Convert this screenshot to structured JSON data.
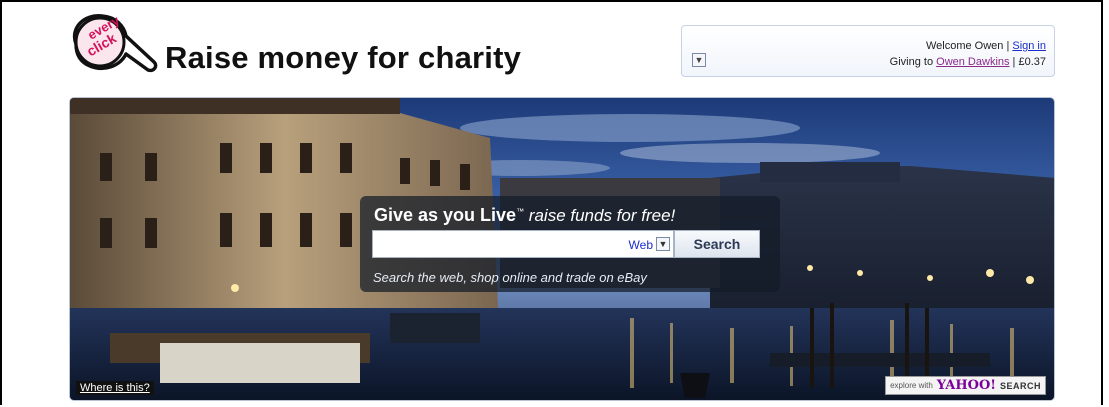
{
  "header": {
    "logo_text_line1": "every",
    "logo_text_line2": "click",
    "title": "Raise money for charity"
  },
  "account": {
    "welcome_text": "Welcome Owen | ",
    "sign_in_label": "Sign in",
    "giving_prefix": "Giving to ",
    "charity_name": "Owen Dawkins",
    "giving_amount": " | £0.37",
    "toggle_icon": "chevron-down-icon"
  },
  "search": {
    "brand": "Give as you Live",
    "trademark": "™",
    "tagline": " raise funds for free!",
    "input_value": "",
    "input_placeholder": "",
    "scope_selected": "Web",
    "button_label": "Search",
    "subtitle": "Search the web, shop online and trade on eBay"
  },
  "hero": {
    "where_link": "Where is this?",
    "yahoo_prefix": "explore with",
    "yahoo_brand": "YAHOO!",
    "yahoo_suffix": "SEARCH"
  },
  "colors": {
    "link": "#1a2fcc",
    "visited_link": "#8a2a8a",
    "logo_accent": "#d4145a"
  }
}
